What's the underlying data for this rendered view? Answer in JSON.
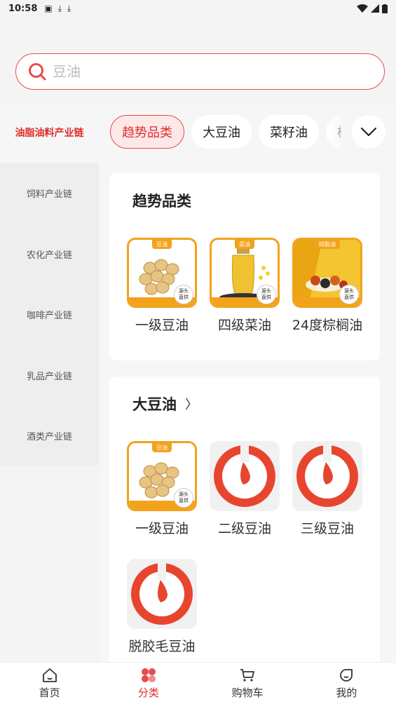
{
  "status_bar": {
    "time": "10:58"
  },
  "search": {
    "placeholder": "豆油"
  },
  "left_nav": {
    "items": [
      {
        "label": "油脂油料产业链",
        "active": true
      },
      {
        "label": "饲料产业链"
      },
      {
        "label": "农化产业链"
      },
      {
        "label": "咖啡产业链"
      },
      {
        "label": "乳品产业链"
      },
      {
        "label": "酒类产业链"
      }
    ]
  },
  "chips": {
    "items": [
      {
        "label": "趋势品类",
        "active": true
      },
      {
        "label": "大豆油"
      },
      {
        "label": "菜籽油"
      },
      {
        "label": "棕"
      }
    ]
  },
  "sections": [
    {
      "title": "趋势品类",
      "products": [
        {
          "name": "一级豆油",
          "tag": "豆油",
          "icon": "soybean-icon"
        },
        {
          "name": "四级菜油",
          "tag": "菜油",
          "icon": "rapeseed-oil-icon"
        },
        {
          "name": "24度棕榈油",
          "tag": "棕脂油",
          "icon": "palm-oil-icon"
        }
      ]
    },
    {
      "title": "大豆油",
      "arrow": "〉",
      "products": [
        {
          "name": "一级豆油",
          "tag": "豆油",
          "icon": "soybean-icon"
        },
        {
          "name": "二级豆油",
          "icon": "brand-logo-icon"
        },
        {
          "name": "三级豆油",
          "icon": "brand-logo-icon"
        },
        {
          "name": "脱胶毛豆油",
          "icon": "brand-logo-icon"
        }
      ]
    }
  ],
  "seal_text": "源头直供",
  "tabbar": {
    "items": [
      {
        "label": "首页",
        "icon": "home-icon"
      },
      {
        "label": "分类",
        "icon": "category-icon",
        "active": true
      },
      {
        "label": "购物车",
        "icon": "cart-icon"
      },
      {
        "label": "我的",
        "icon": "profile-icon"
      }
    ]
  },
  "colors": {
    "accent": "#e02b2b",
    "tag_orange": "#f3a21b",
    "logo_red": "#e8452f"
  }
}
